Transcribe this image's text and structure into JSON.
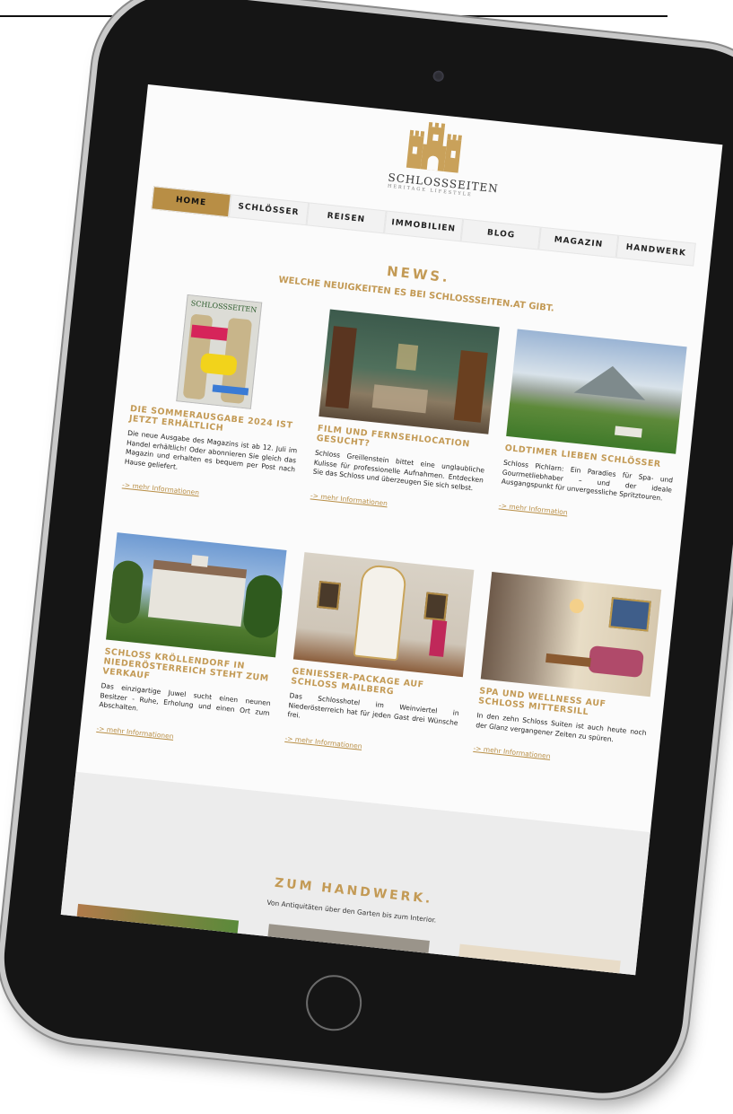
{
  "brand": {
    "name": "SCHLOSSSEITEN",
    "tagline": "HERITAGE LIFESTYLE",
    "color": "#c39a55"
  },
  "nav": {
    "items": [
      "HOME",
      "SCHLÖSSER",
      "REISEN",
      "IMMOBILIEN",
      "BLOG",
      "MAGAZIN",
      "HANDWERK"
    ],
    "active": "HOME"
  },
  "news": {
    "title": "NEWS.",
    "subtitle": "WELCHE NEUIGKEITEN ES BEI SCHLOSSSEITEN.AT GIBT."
  },
  "cards": [
    {
      "title": "DIE SOMMERAUSGABE 2024 IST JETZT ERHÄLTLICH",
      "text": "Die neue Ausgabe des Magazins ist ab 12. Juli im Handel erhältlich! Oder abonnieren Sie gleich das Magazin und erhalten es bequem per Post nach Hause geliefert.",
      "link": "-> mehr Informationen",
      "image": "magazine-cover"
    },
    {
      "title": "FILM UND FERNSEHLOCATION GESUCHT?",
      "text": "Schloss Greillenstein bittet eine unglaubliche Kulisse für professionelle Aufnahmen. Entdecken Sie das Schloss und überzeugen Sie sich selbst.",
      "link": "-> mehr Informationen",
      "image": "castle-interior"
    },
    {
      "title": "OLDTIMER LIEBEN SCHLÖSSER",
      "text": "Schloss Pichlarn: Ein Paradies für Spa- und Gourmetliebhaber – und der ideale Ausgangspunkt für unvergessliche Spritztouren.",
      "link": "-> mehr Information",
      "image": "landscape"
    },
    {
      "title": "SCHLOSS KRÖLLENDORF IN NIEDERÖSTERREICH STEHT ZUM VERKAUF",
      "text": "Das einzigartige Juwel sucht einen neunen Besitzer - Ruhe, Erholung und einen Ort zum Abschalten.",
      "link": "-> mehr Informationen",
      "image": "castle-exterior"
    },
    {
      "title": "GENIESSER-PACKAGE AUF SCHLOSS MAILBERG",
      "text": "Das Schlosshotel im Weinviertel in Niederösterreich hat für jeden Gast drei Wünsche frei.",
      "link": "-> mehr Informationen",
      "image": "tiled-stove-room"
    },
    {
      "title": "SPA UND WELLNESS AUF SCHLOSS MITTERSILL",
      "text": "In den zehn Schloss Suiten ist auch heute noch der Glanz vergangener Zeiten zu spüren.",
      "link": "-> mehr Informationen",
      "image": "suite-room"
    }
  ],
  "magazine": {
    "cover_title": "SCHLOSSSEITEN"
  },
  "handwerk": {
    "title": "ZUM HANDWERK.",
    "subtitle": "Von Antiquitäten über den Garten bis zum Interior."
  }
}
